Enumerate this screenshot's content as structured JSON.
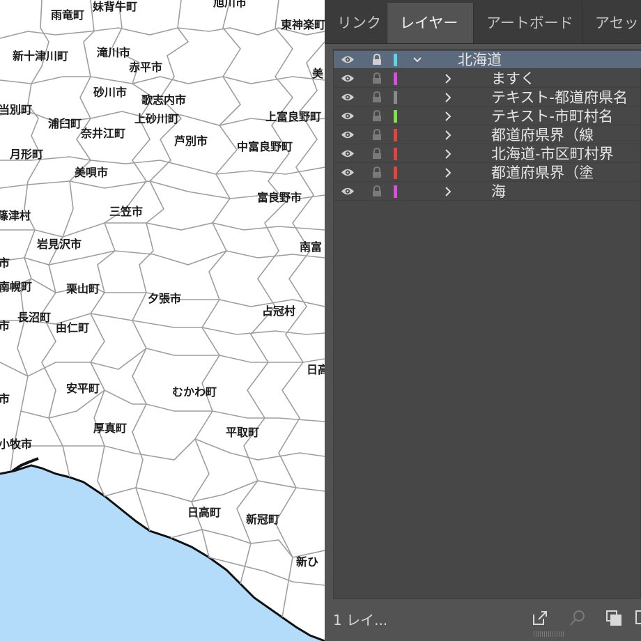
{
  "panel": {
    "tabs": [
      {
        "label": "リンク"
      },
      {
        "label": "レイヤー"
      },
      {
        "label": "アートボード"
      },
      {
        "label": "アセット"
      }
    ],
    "active_tab": "レイヤー",
    "layers": [
      {
        "name": "北海道",
        "color": "#5ad6e8",
        "expanded": true,
        "selected": true
      },
      {
        "name": "ますく",
        "color": "#d94fe0"
      },
      {
        "name": "テキスト-都道府県名",
        "color": "#8a8a8a"
      },
      {
        "name": "テキスト-市町村名",
        "color": "#7fe04a"
      },
      {
        "name": "都道府県界（線",
        "color": "#e0453d"
      },
      {
        "name": "北海道-市区町村界",
        "color": "#e0453d"
      },
      {
        "name": "都道府県界（塗",
        "color": "#e0453d"
      },
      {
        "name": "海",
        "color": "#d94fe0"
      }
    ],
    "footer": {
      "count_label": "1 レイ..."
    }
  },
  "map": {
    "sea_color": "#b3dcfa",
    "labels": [
      {
        "text": "雨竜町"
      },
      {
        "text": "妹背牛町"
      },
      {
        "text": "旭川市"
      },
      {
        "text": "東神楽町"
      },
      {
        "text": "新十津川町"
      },
      {
        "text": "滝川市"
      },
      {
        "text": "赤平市"
      },
      {
        "text": "美"
      },
      {
        "text": "砂川市"
      },
      {
        "text": "歌志内市"
      },
      {
        "text": "上砂川町"
      },
      {
        "text": "当別町"
      },
      {
        "text": "浦臼町"
      },
      {
        "text": "奈井江町"
      },
      {
        "text": "上富良野町"
      },
      {
        "text": "芦別市"
      },
      {
        "text": "中富良野町"
      },
      {
        "text": "月形町"
      },
      {
        "text": "美唄市"
      },
      {
        "text": "富良野市"
      },
      {
        "text": "篠津村"
      },
      {
        "text": "三笠市"
      },
      {
        "text": "岩見沢市"
      },
      {
        "text": "南富"
      },
      {
        "text": "市"
      },
      {
        "text": "南幌町"
      },
      {
        "text": "栗山町"
      },
      {
        "text": "夕張市"
      },
      {
        "text": "占冠村"
      },
      {
        "text": "長沼町"
      },
      {
        "text": "市"
      },
      {
        "text": "由仁町"
      },
      {
        "text": "日高"
      },
      {
        "text": "安平町"
      },
      {
        "text": "むかわ町"
      },
      {
        "text": "市"
      },
      {
        "text": "厚真町"
      },
      {
        "text": "平取町"
      },
      {
        "text": "小牧市"
      },
      {
        "text": "日高町"
      },
      {
        "text": "新冠町"
      },
      {
        "text": "新ひ"
      }
    ]
  }
}
